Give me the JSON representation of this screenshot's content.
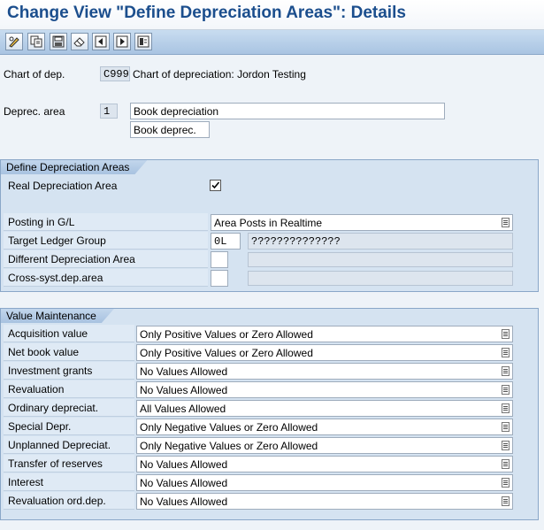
{
  "window": {
    "title": "Change View \"Define Depreciation Areas\": Details"
  },
  "toolbar": {
    "buttons": [
      {
        "icon": "pencil-glasses-icon"
      },
      {
        "icon": "copy-icon"
      },
      {
        "icon": "save-variant-icon"
      },
      {
        "icon": "eraser-icon"
      },
      {
        "icon": "previous-entry-icon"
      },
      {
        "icon": "next-entry-icon"
      },
      {
        "icon": "select-icon"
      }
    ]
  },
  "header": {
    "chart_of_dep_label": "Chart of dep.",
    "chart_of_dep_value": "C999",
    "chart_of_dep_desc": "Chart of depreciation: Jordon Testing",
    "deprec_area_label": "Deprec. area",
    "deprec_area_value": "1",
    "deprec_area_name": "Book depreciation",
    "deprec_area_short": "Book deprec."
  },
  "define_group": {
    "title": "Define Depreciation Areas",
    "real_area_label": "Real Depreciation Area",
    "real_area_checked": true,
    "posting_label": "Posting in G/L",
    "posting_value": "Area Posts in Realtime",
    "target_label": "Target Ledger Group",
    "target_value": "0L",
    "target_desc": "??????????????",
    "diff_label": "Different Depreciation Area",
    "cross_label": "Cross-syst.dep.area"
  },
  "value_group": {
    "title": "Value Maintenance",
    "rows": [
      {
        "label": "Acquisition value",
        "value": "Only Positive Values or Zero Allowed"
      },
      {
        "label": "Net book value",
        "value": "Only Positive Values or Zero Allowed"
      },
      {
        "label": "Investment grants",
        "value": "No Values Allowed"
      },
      {
        "label": "Revaluation",
        "value": "No Values Allowed"
      },
      {
        "label": "Ordinary depreciat.",
        "value": "All Values Allowed"
      },
      {
        "label": "Special Depr.",
        "value": "Only Negative Values or Zero Allowed"
      },
      {
        "label": "Unplanned Depreciat.",
        "value": "Only Negative Values or Zero Allowed"
      },
      {
        "label": "Transfer of reserves",
        "value": "No Values Allowed"
      },
      {
        "label": "Interest",
        "value": "No Values Allowed"
      },
      {
        "label": "Revaluation ord.dep.",
        "value": "No Values Allowed"
      }
    ]
  }
}
